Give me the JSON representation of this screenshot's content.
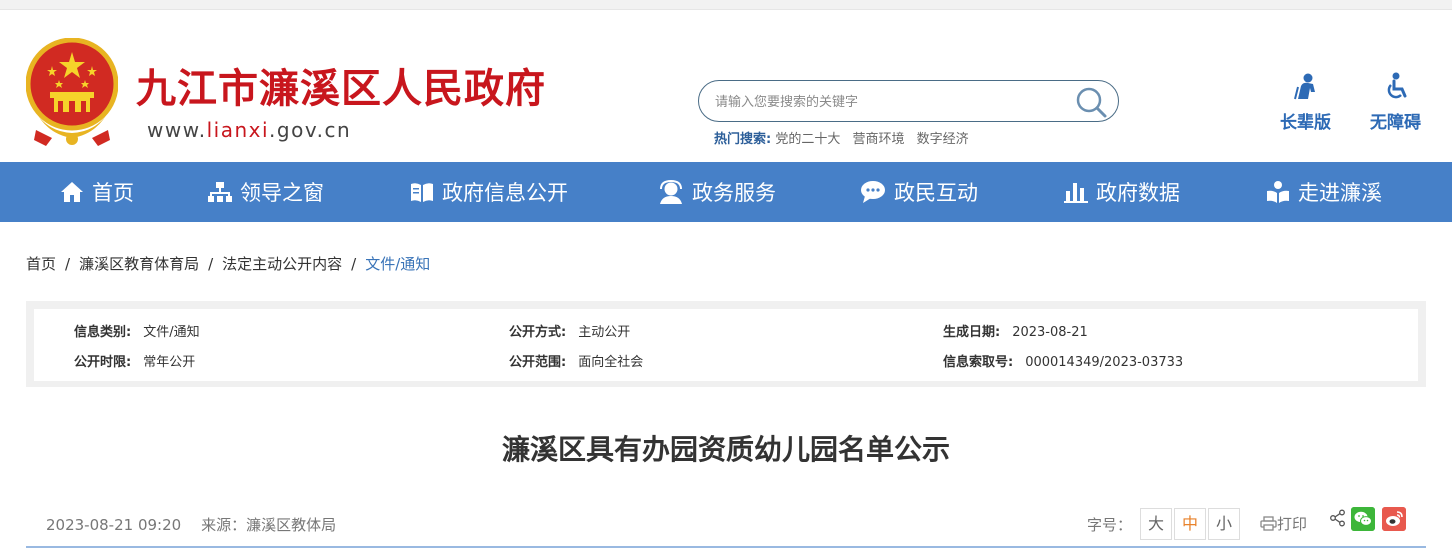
{
  "header": {
    "site_title": "九江市濂溪区人民政府",
    "url_prefix": "www.",
    "url_highlight": "lianxi",
    "url_suffix": ".gov.cn",
    "search_placeholder": "请输入您要搜索的关键字",
    "hot_label": "热门搜索:",
    "hot_terms": [
      "党的二十大",
      "营商环境",
      "数字经济"
    ],
    "tools": [
      {
        "label": "长辈版",
        "icon": "elder-icon"
      },
      {
        "label": "无障碍",
        "icon": "wheelchair-icon"
      }
    ]
  },
  "nav": {
    "items": [
      {
        "label": "首页",
        "icon": "home-icon"
      },
      {
        "label": "领导之窗",
        "icon": "org-chart-icon"
      },
      {
        "label": "政府信息公开",
        "icon": "book-icon"
      },
      {
        "label": "政务服务",
        "icon": "service-person-icon"
      },
      {
        "label": "政民互动",
        "icon": "chat-icon"
      },
      {
        "label": "政府数据",
        "icon": "bar-chart-icon"
      },
      {
        "label": "走进濂溪",
        "icon": "reader-icon"
      }
    ]
  },
  "breadcrumb": [
    "首页",
    "濂溪区教育体育局",
    "法定主动公开内容",
    "文件/通知"
  ],
  "meta": {
    "category_key": "信息类别:",
    "category_val": "文件/通知",
    "method_key": "公开方式:",
    "method_val": "主动公开",
    "date_key": "生成日期:",
    "date_val": "2023-08-21",
    "period_key": "公开时限:",
    "period_val": "常年公开",
    "scope_key": "公开范围:",
    "scope_val": "面向全社会",
    "index_key": "信息索取号:",
    "index_val": "000014349/2023-03733"
  },
  "article": {
    "title": "濂溪区具有办园资质幼儿园名单公示",
    "datetime": "2023-08-21 09:20",
    "source": "来源：濂溪区教体局",
    "font_size_label": "字号：",
    "font_sizes": [
      "大",
      "中",
      "小"
    ],
    "print_label": "打印"
  },
  "colors": {
    "brand_red": "#c8161d",
    "nav_blue": "#4680c8",
    "accent_orange": "#e8822b"
  }
}
